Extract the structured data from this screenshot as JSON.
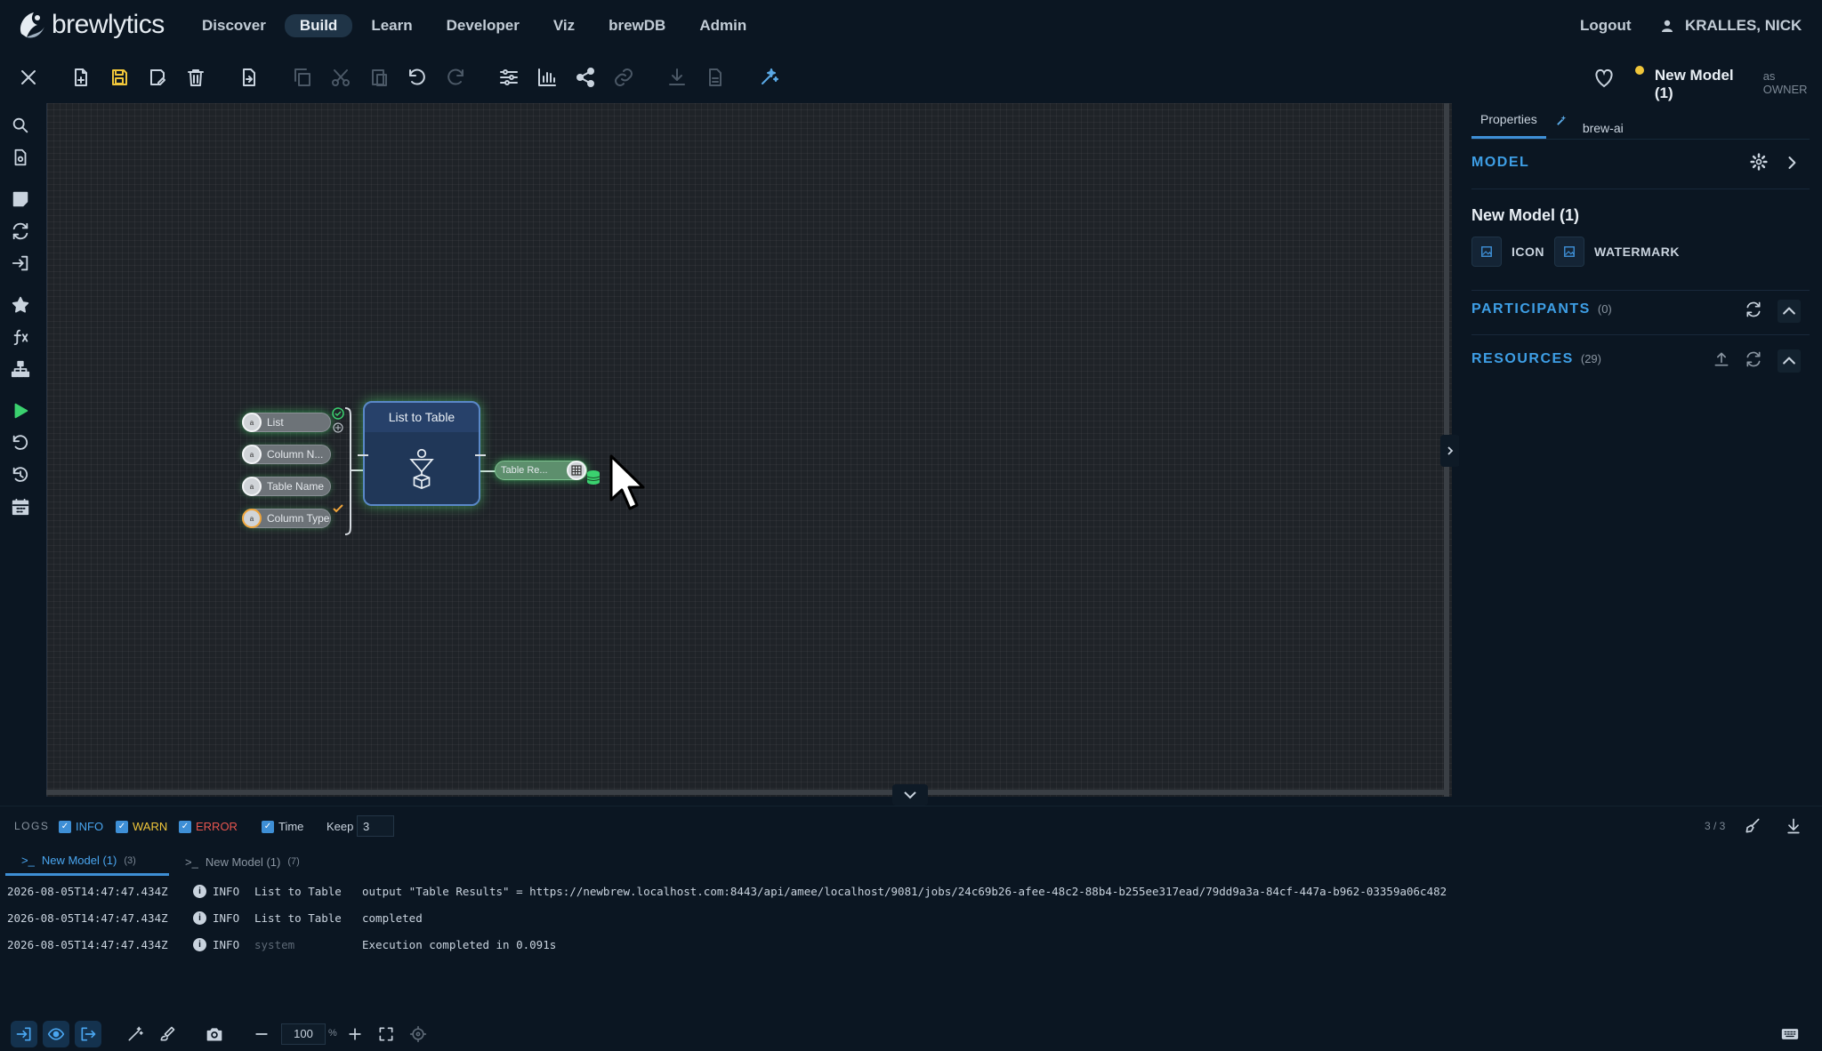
{
  "nav": {
    "brand": "brewlytics",
    "links": [
      "Discover",
      "Build",
      "Learn",
      "Developer",
      "Viz",
      "brewDB",
      "Admin"
    ],
    "active": "Build",
    "logout": "Logout",
    "user": "KRALLES, NICK"
  },
  "model_header": {
    "title": "New Model (1)",
    "role": "as OWNER",
    "status_color": "#f0c63a"
  },
  "toolbar": {
    "icons": [
      "close-icon",
      "new-file-icon",
      "save-icon",
      "save-as-icon",
      "delete-icon",
      "export-icon",
      "copy-icon",
      "cut-icon",
      "paste-icon",
      "undo-icon",
      "redo-icon",
      "settings-sliders-icon",
      "chart-icon",
      "share-icon",
      "link-icon",
      "download-icon",
      "file-icon",
      "brew-ai-icon"
    ]
  },
  "left_rail": {
    "icons": [
      "search-icon",
      "document-icon",
      "note-icon",
      "refresh-icon",
      "sign-in-icon",
      "star-icon",
      "function-icon",
      "hierarchy-icon",
      "play-icon",
      "reset-icon",
      "history-icon",
      "calendar-icon"
    ]
  },
  "canvas": {
    "node": {
      "title": "List to Table",
      "inputs": [
        "List",
        "Column N...",
        "Table Name",
        "Column Type"
      ],
      "output": "Table Re..."
    }
  },
  "right_panel": {
    "tabs": [
      "Properties",
      "brew-ai"
    ],
    "active_tab": "Properties",
    "model_section": "MODEL",
    "model_name": "New Model (1)",
    "chip_icon": "ICON",
    "chip_watermark": "WATERMARK",
    "participants_label": "PARTICIPANTS",
    "participants_count": "(0)",
    "resources_label": "RESOURCES",
    "resources_count": "(29)",
    "accent": "#3e9fe6"
  },
  "logs": {
    "label": "LOGS",
    "filters": {
      "info": "INFO",
      "warn": "WARN",
      "error": "ERROR",
      "time": "Time"
    },
    "keep_label": "Keep",
    "keep_value": "3",
    "page": "3 / 3",
    "tabs": [
      {
        "name": "New Model (1)",
        "count": "(3)"
      },
      {
        "name": "New Model (1)",
        "count": "(7)"
      }
    ],
    "rows": [
      {
        "time": "2026-08-05T14:47:47.434Z",
        "level": "INFO",
        "source": "List to Table",
        "message": "output \"Table Results\" = https://newbrew.localhost.com:8443/api/amee/localhost/9081/jobs/24c69b26-afee-48c2-88b4-b255ee317ead/79dd9a3a-84cf-447a-b962-03359a06c482"
      },
      {
        "time": "2026-08-05T14:47:47.434Z",
        "level": "INFO",
        "source": "List to Table",
        "message": "completed"
      },
      {
        "time": "2026-08-05T14:47:47.434Z",
        "level": "INFO",
        "source": "system",
        "message": "Execution completed in 0.091s"
      }
    ]
  },
  "bottom_bar": {
    "zoom": "100",
    "zoom_unit": "%"
  }
}
